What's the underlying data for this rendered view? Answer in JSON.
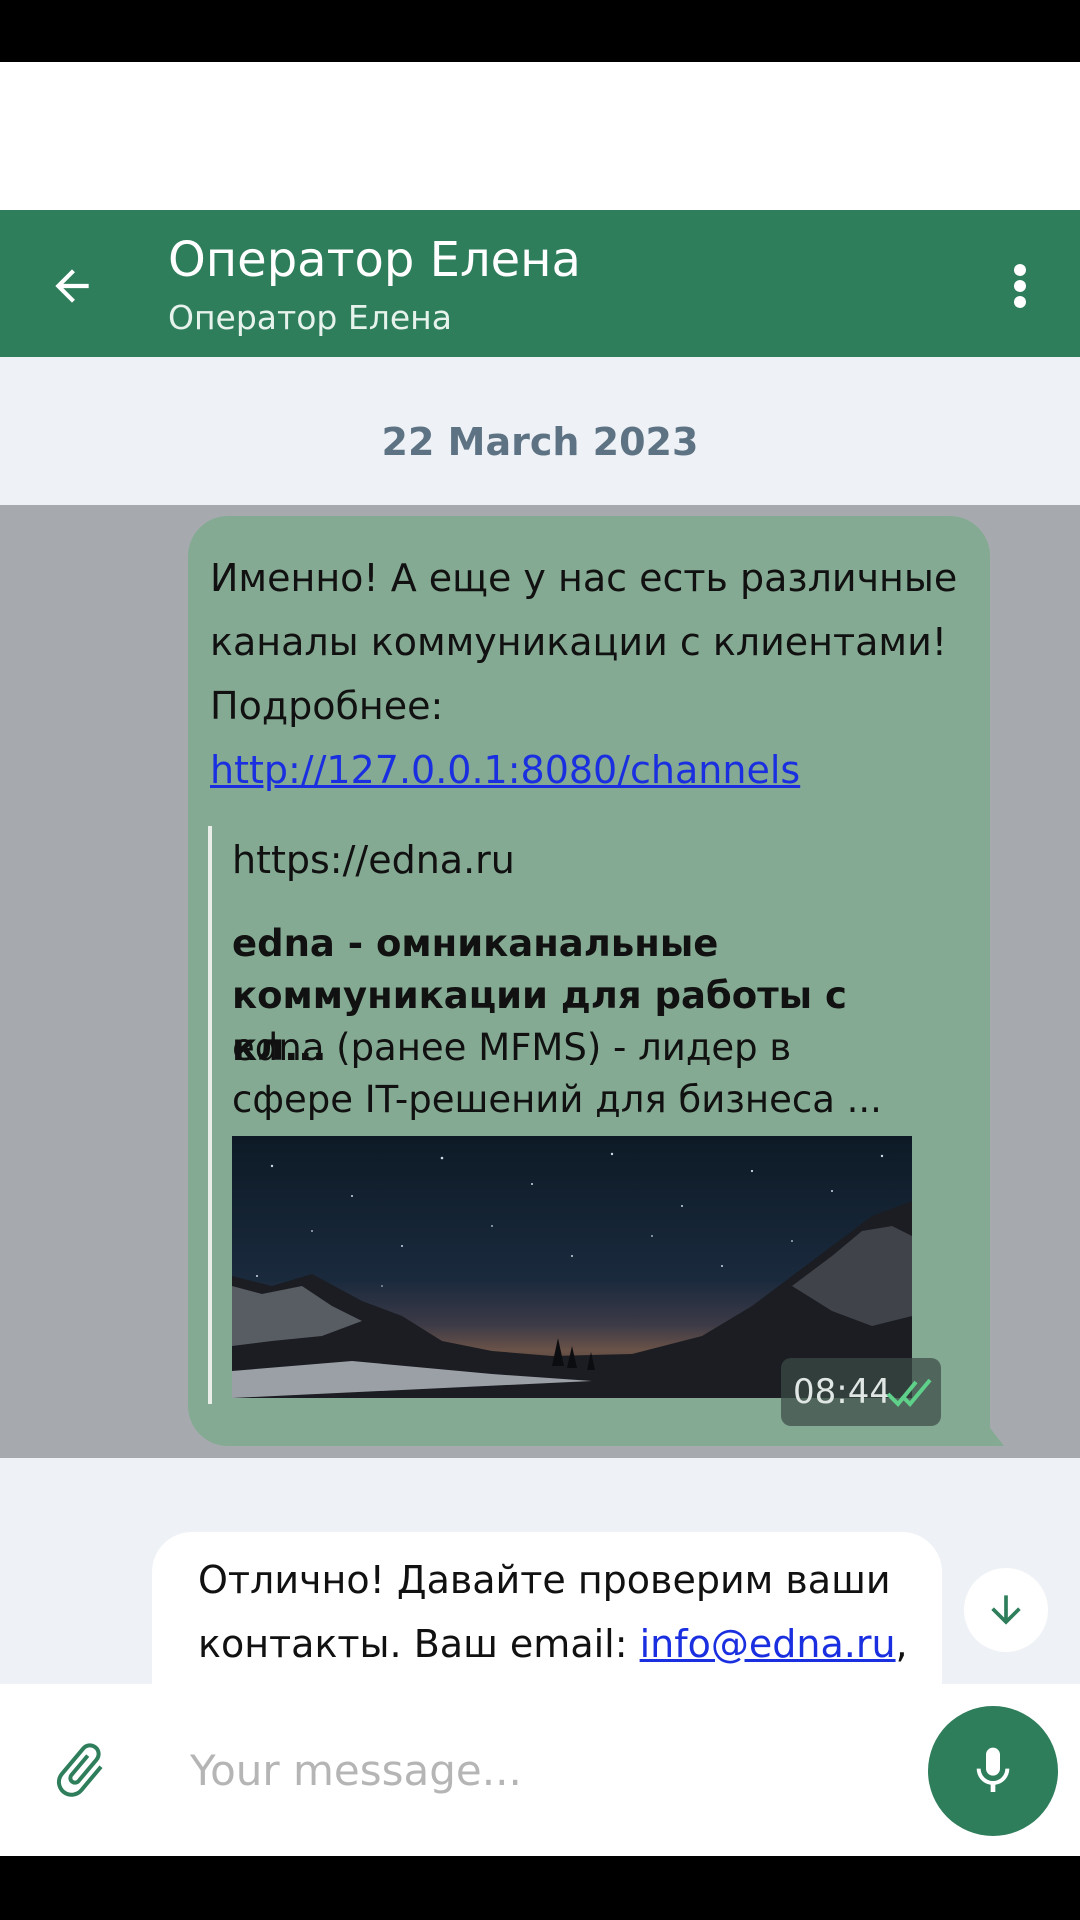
{
  "header": {
    "title": "Оператор Елена",
    "subtitle": "Оператор Елена",
    "back_icon": "arrow-left-icon",
    "menu_icon": "more-vertical-icon"
  },
  "date_separator": "22 March 2023",
  "outgoing_message": {
    "text_before_link": "Именно! А еще у нас есть различные каналы коммуникации с клиентами! Подробнее: ",
    "link_text": "http://127.0.0.1:8080/channels",
    "link_preview": {
      "url": "https://edna.ru",
      "title": "edna - омниканальные коммуникации для работы с кл...",
      "description": "edna (ранее MFMS) - лидер в сфере IT-решений для бизнеса ...",
      "image": "night-mountains-image"
    },
    "time": "08:44",
    "status_icon": "double-check-icon"
  },
  "incoming_message": {
    "text_before_link": "Отлично! Давайте проверим ваши контакты. Ваш email: ",
    "link_text": "info@edna.ru",
    "text_after_link": ","
  },
  "composer": {
    "placeholder": "Your message...",
    "attach_icon": "paperclip-icon",
    "mic_icon": "microphone-icon"
  },
  "scroll_down_icon": "arrow-down-icon",
  "colors": {
    "primary": "#2e7d5b",
    "outgoing_bubble": "#85aa93",
    "link": "#1a2fe0",
    "date_text": "#5d7384"
  }
}
